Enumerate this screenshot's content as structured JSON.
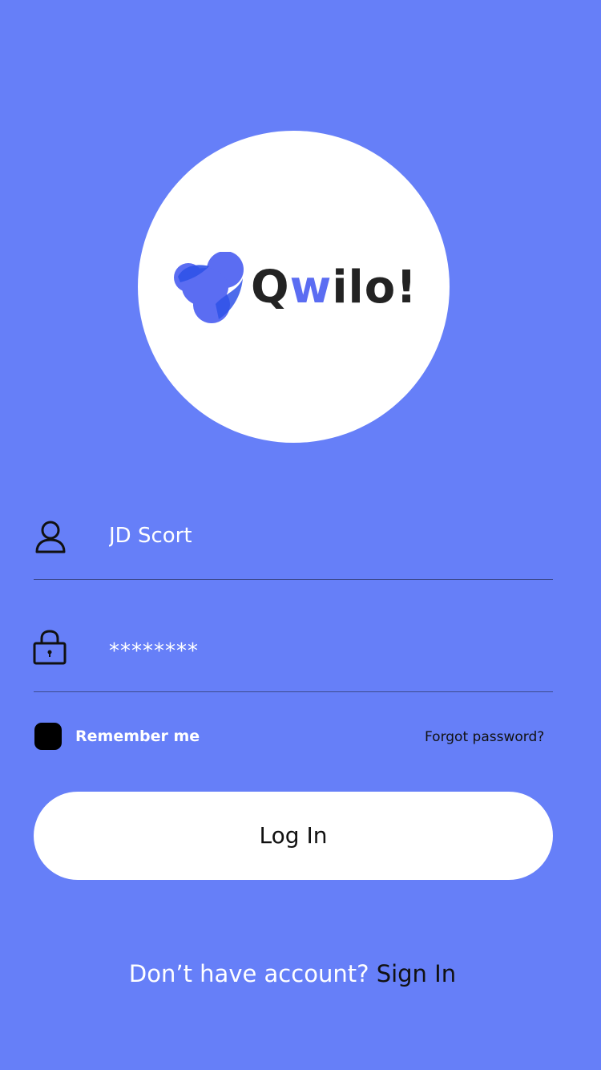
{
  "brand": {
    "name_prefix": "Q",
    "name_accent": "w",
    "name_suffix": "ilo!",
    "logo_icon": "blob-logo-icon",
    "logo_colors": {
      "primary": "#5b6df2",
      "secondary": "#2f52e8"
    }
  },
  "form": {
    "username": {
      "icon": "user-icon",
      "value": "JD Scort"
    },
    "password": {
      "icon": "lock-icon",
      "value": "********"
    },
    "remember_label": "Remember me",
    "forgot_label": "Forgot password?",
    "login_label": "Log In"
  },
  "footer": {
    "prompt": "Don’t have account?",
    "sign_in_label": "Sign In"
  },
  "colors": {
    "background": "#667ff8",
    "surface": "#ffffff",
    "text_dark": "#111111",
    "line": "#3d4a8e"
  }
}
